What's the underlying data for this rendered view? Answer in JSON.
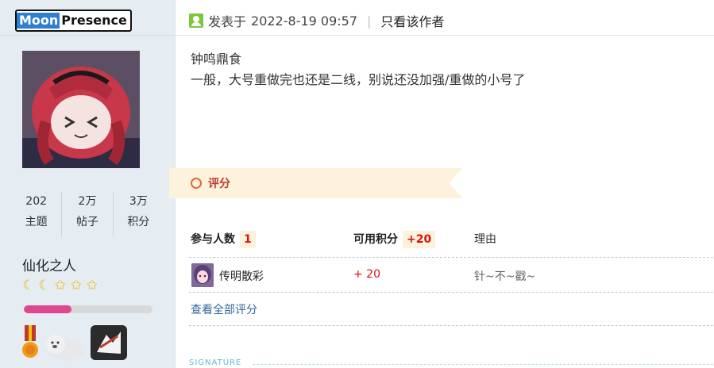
{
  "author": {
    "name_part1": "Moon",
    "name_part2": "Presence",
    "stats": [
      {
        "value": "202",
        "label": "主题"
      },
      {
        "value": "2万",
        "label": "帖子"
      },
      {
        "value": "3万",
        "label": "积分"
      }
    ],
    "rank_title": "仙化之人",
    "rank_icons": [
      "moon-icon",
      "moon-icon",
      "star-icon",
      "star-icon",
      "star-icon"
    ],
    "progress": 0.37,
    "medals": [
      "medal-icon",
      "seal-icon",
      "badge-icon"
    ]
  },
  "post": {
    "posted_prefix": "发表于",
    "posted_time": "2022-8-19 09:57",
    "separator": "|",
    "only_author": "只看该作者",
    "lines": [
      "钟鸣鼎食",
      "一般，大号重做完也还是二线，别说还没加强/重做的小号了"
    ]
  },
  "rating": {
    "title": "评分",
    "participants_label": "参与人数",
    "participants_count": "1",
    "points_label": "可用积分",
    "points_total": "+20",
    "reason_label": "理由",
    "rows": [
      {
        "user": "传明散彩",
        "score": "+ 20",
        "reason": "针~不~戳~"
      }
    ],
    "view_all": "查看全部评分"
  },
  "signature": {
    "label": "SIGNATURE"
  },
  "colors": {
    "sidebar_bg": "#e5edf2",
    "accent_red": "#dd1111",
    "link": "#336699",
    "banner": "#fdf3dc",
    "progress_fill": "#e0478f"
  }
}
